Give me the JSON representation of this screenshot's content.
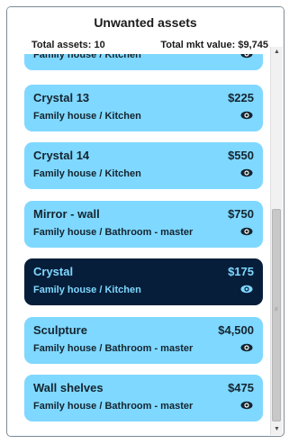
{
  "header": {
    "title": "Unwanted assets",
    "total_assets_label": "Total assets:",
    "total_assets_value": "10",
    "total_value_label": "Total mkt value:",
    "total_value_value": "$9,745"
  },
  "assets": [
    {
      "name": "",
      "price": "",
      "location": "Family house / Kitchen",
      "selected": false,
      "icon": "eye-icon"
    },
    {
      "name": "Crystal 13",
      "price": "$225",
      "location": "Family house / Kitchen",
      "selected": false,
      "icon": "eye-icon"
    },
    {
      "name": "Crystal 14",
      "price": "$550",
      "location": "Family house / Kitchen",
      "selected": false,
      "icon": "eye-icon"
    },
    {
      "name": "Mirror - wall",
      "price": "$750",
      "location": "Family house / Bathroom - master",
      "selected": false,
      "icon": "eye-icon"
    },
    {
      "name": "Crystal",
      "price": "$175",
      "location": "Family house / Kitchen",
      "selected": true,
      "icon": "eye-icon"
    },
    {
      "name": "Sculpture",
      "price": "$4,500",
      "location": "Family house / Bathroom - master",
      "selected": false,
      "icon": "eye-icon"
    },
    {
      "name": "Wall shelves",
      "price": "$475",
      "location": "Family house / Bathroom - master",
      "selected": false,
      "icon": "eye-icon"
    }
  ],
  "scrollbar": {
    "up_arrow": "▲",
    "down_arrow": "▼",
    "grip": "≡"
  },
  "colors": {
    "card_bg": "#7fd8ff",
    "card_text": "#14242f",
    "selected_bg": "#071e3a",
    "selected_text": "#7fd8ff"
  }
}
